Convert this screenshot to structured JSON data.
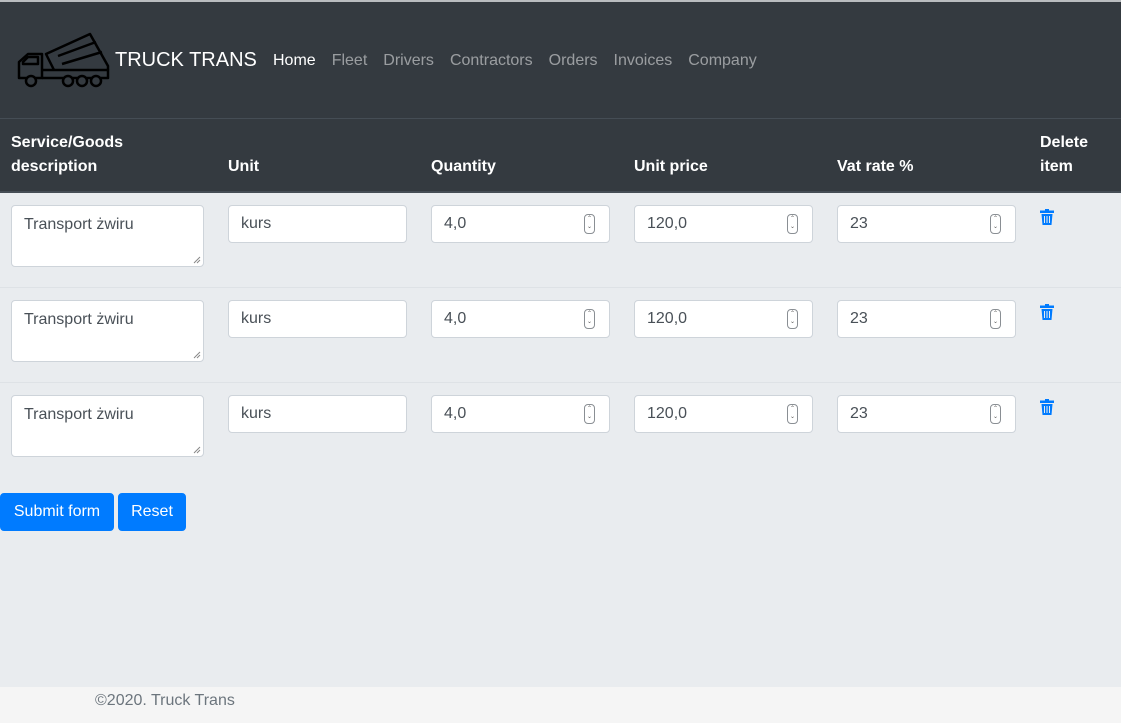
{
  "brand": {
    "name": "TRUCK TRANS"
  },
  "nav": {
    "items": [
      {
        "label": "Home"
      },
      {
        "label": "Fleet"
      },
      {
        "label": "Drivers"
      },
      {
        "label": "Contractors"
      },
      {
        "label": "Orders"
      },
      {
        "label": "Invoices"
      },
      {
        "label": "Company"
      }
    ]
  },
  "table": {
    "headers": {
      "description_line1": "Service/Goods",
      "description_line2": "description",
      "unit": "Unit",
      "quantity": "Quantity",
      "unit_price": "Unit price",
      "vat_rate": "Vat rate %",
      "delete_line1": "Delete",
      "delete_line2": "item"
    },
    "rows": [
      {
        "description": "Transport żwiru",
        "unit": "kurs",
        "quantity": "4,0",
        "unit_price": "120,0",
        "vat_rate": "23"
      },
      {
        "description": "Transport żwiru",
        "unit": "kurs",
        "quantity": "4,0",
        "unit_price": "120,0",
        "vat_rate": "23"
      },
      {
        "description": "Transport żwiru",
        "unit": "kurs",
        "quantity": "4,0",
        "unit_price": "120,0",
        "vat_rate": "23"
      }
    ]
  },
  "actions": {
    "submit_label": "Submit form",
    "reset_label": "Reset"
  },
  "footer": {
    "copyright": "©2020. Truck Trans"
  },
  "icons": {
    "logo": "dump-truck-icon",
    "delete": "trash-icon"
  },
  "colors": {
    "navbar": "#343a40",
    "primary": "#007bff",
    "page_bg": "#e9ecef"
  }
}
